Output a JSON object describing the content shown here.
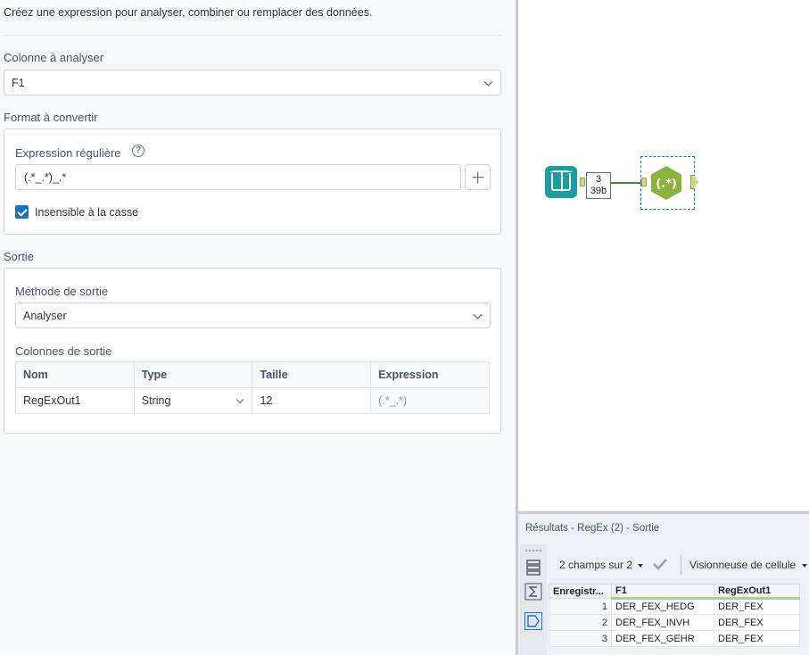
{
  "config": {
    "intro": "Créez une expression pour analyser, combiner ou remplacer des données.",
    "column_label": "Colonne à analyser",
    "column_value": "F1",
    "format_label": "Format à convertir",
    "regex_label": "Expression régulière",
    "regex_value": "(.*_.*)_.*",
    "case_insensitive_label": "Insensible à la casse",
    "case_insensitive_checked": true,
    "output_label": "Sortie",
    "method_label": "Méthode de sortie",
    "method_value": "Analyser",
    "output_columns_label": "Colonnes de sortie",
    "output_columns": {
      "headers": [
        "Nom",
        "Type",
        "Taille",
        "Expression"
      ],
      "rows": [
        {
          "name": "RegExOut1",
          "type": "String",
          "size": "12",
          "expression": "(.*_.*)"
        }
      ]
    }
  },
  "canvas": {
    "count_records": "3",
    "count_size": "39b",
    "regex_tool_glyph": "(.*)",
    "accent_color": "#8cb43c",
    "input_tool_color": "#1a9ea0"
  },
  "results": {
    "title": "Résultats - RegEx (2) - Sortie",
    "fields_count": "2 champs sur 2",
    "viewer_label": "Visionneuse de cellule",
    "grid": {
      "headers": [
        "Enregistr...",
        "F1",
        "RegExOut1"
      ],
      "rows": [
        {
          "record": "1",
          "f1": "DER_FEX_HEDG",
          "out": "DER_FEX"
        },
        {
          "record": "2",
          "f1": "DER_FEX_INVH",
          "out": "DER_FEX"
        },
        {
          "record": "3",
          "f1": "DER_FEX_GEHR",
          "out": "DER_FEX"
        }
      ]
    }
  }
}
